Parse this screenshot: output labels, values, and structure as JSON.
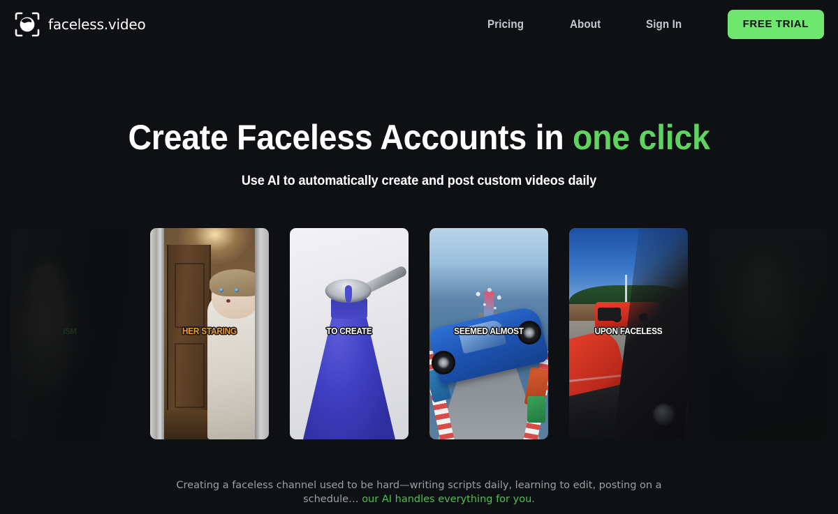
{
  "brand": {
    "name": "faceless.video",
    "logo_icon": "face-scan-icon"
  },
  "nav": {
    "links": [
      {
        "label": "Pricing",
        "name": "pricing"
      },
      {
        "label": "About",
        "name": "about"
      },
      {
        "label": "Sign In",
        "name": "sign-in"
      }
    ],
    "cta": {
      "label": "FREE TRIAL",
      "bg_color": "#6fe76f",
      "text_color": "#0b0d10"
    }
  },
  "hero": {
    "headline_plain": "Create Faceless Accounts in ",
    "headline_accent": "one click",
    "subheadline": "Use AI to automatically create and post custom videos daily",
    "accent_color": "#5fd35f"
  },
  "carousel": {
    "cards": [
      {
        "name": "video-card-dark-left",
        "caption": "ISM",
        "caption_style": "green",
        "scene": "dark-ambient",
        "edge": true
      },
      {
        "name": "video-card-doll",
        "caption": "HER STARING",
        "caption_style": "orange",
        "scene": "doll-in-doorway",
        "edge": false
      },
      {
        "name": "video-card-sand",
        "caption": "TO CREATE",
        "caption_style": "white",
        "scene": "blue-kinetic-sand",
        "edge": false
      },
      {
        "name": "video-card-ramp",
        "caption": "SEEMED ALMOST",
        "caption_style": "white",
        "scene": "blue-car-on-ramp",
        "edge": false
      },
      {
        "name": "video-card-supercar",
        "caption": "UPON FACELESS",
        "caption_style": "white",
        "scene": "red-supercar-from-window",
        "edge": false
      },
      {
        "name": "video-card-dark-right",
        "caption": "",
        "caption_style": "none",
        "scene": "dark-ambient",
        "edge": true
      }
    ]
  },
  "footer": {
    "text_plain": "Creating a faceless channel used to be hard—writing scripts daily, learning to edit, posting on a schedule… ",
    "text_accent": "our AI handles everything for you.",
    "accent_color": "#4cc04c"
  },
  "theme": {
    "background": "#0e1014",
    "text_primary": "#ffffff",
    "text_muted": "#9aa0a8",
    "green": "#6fe76f"
  }
}
